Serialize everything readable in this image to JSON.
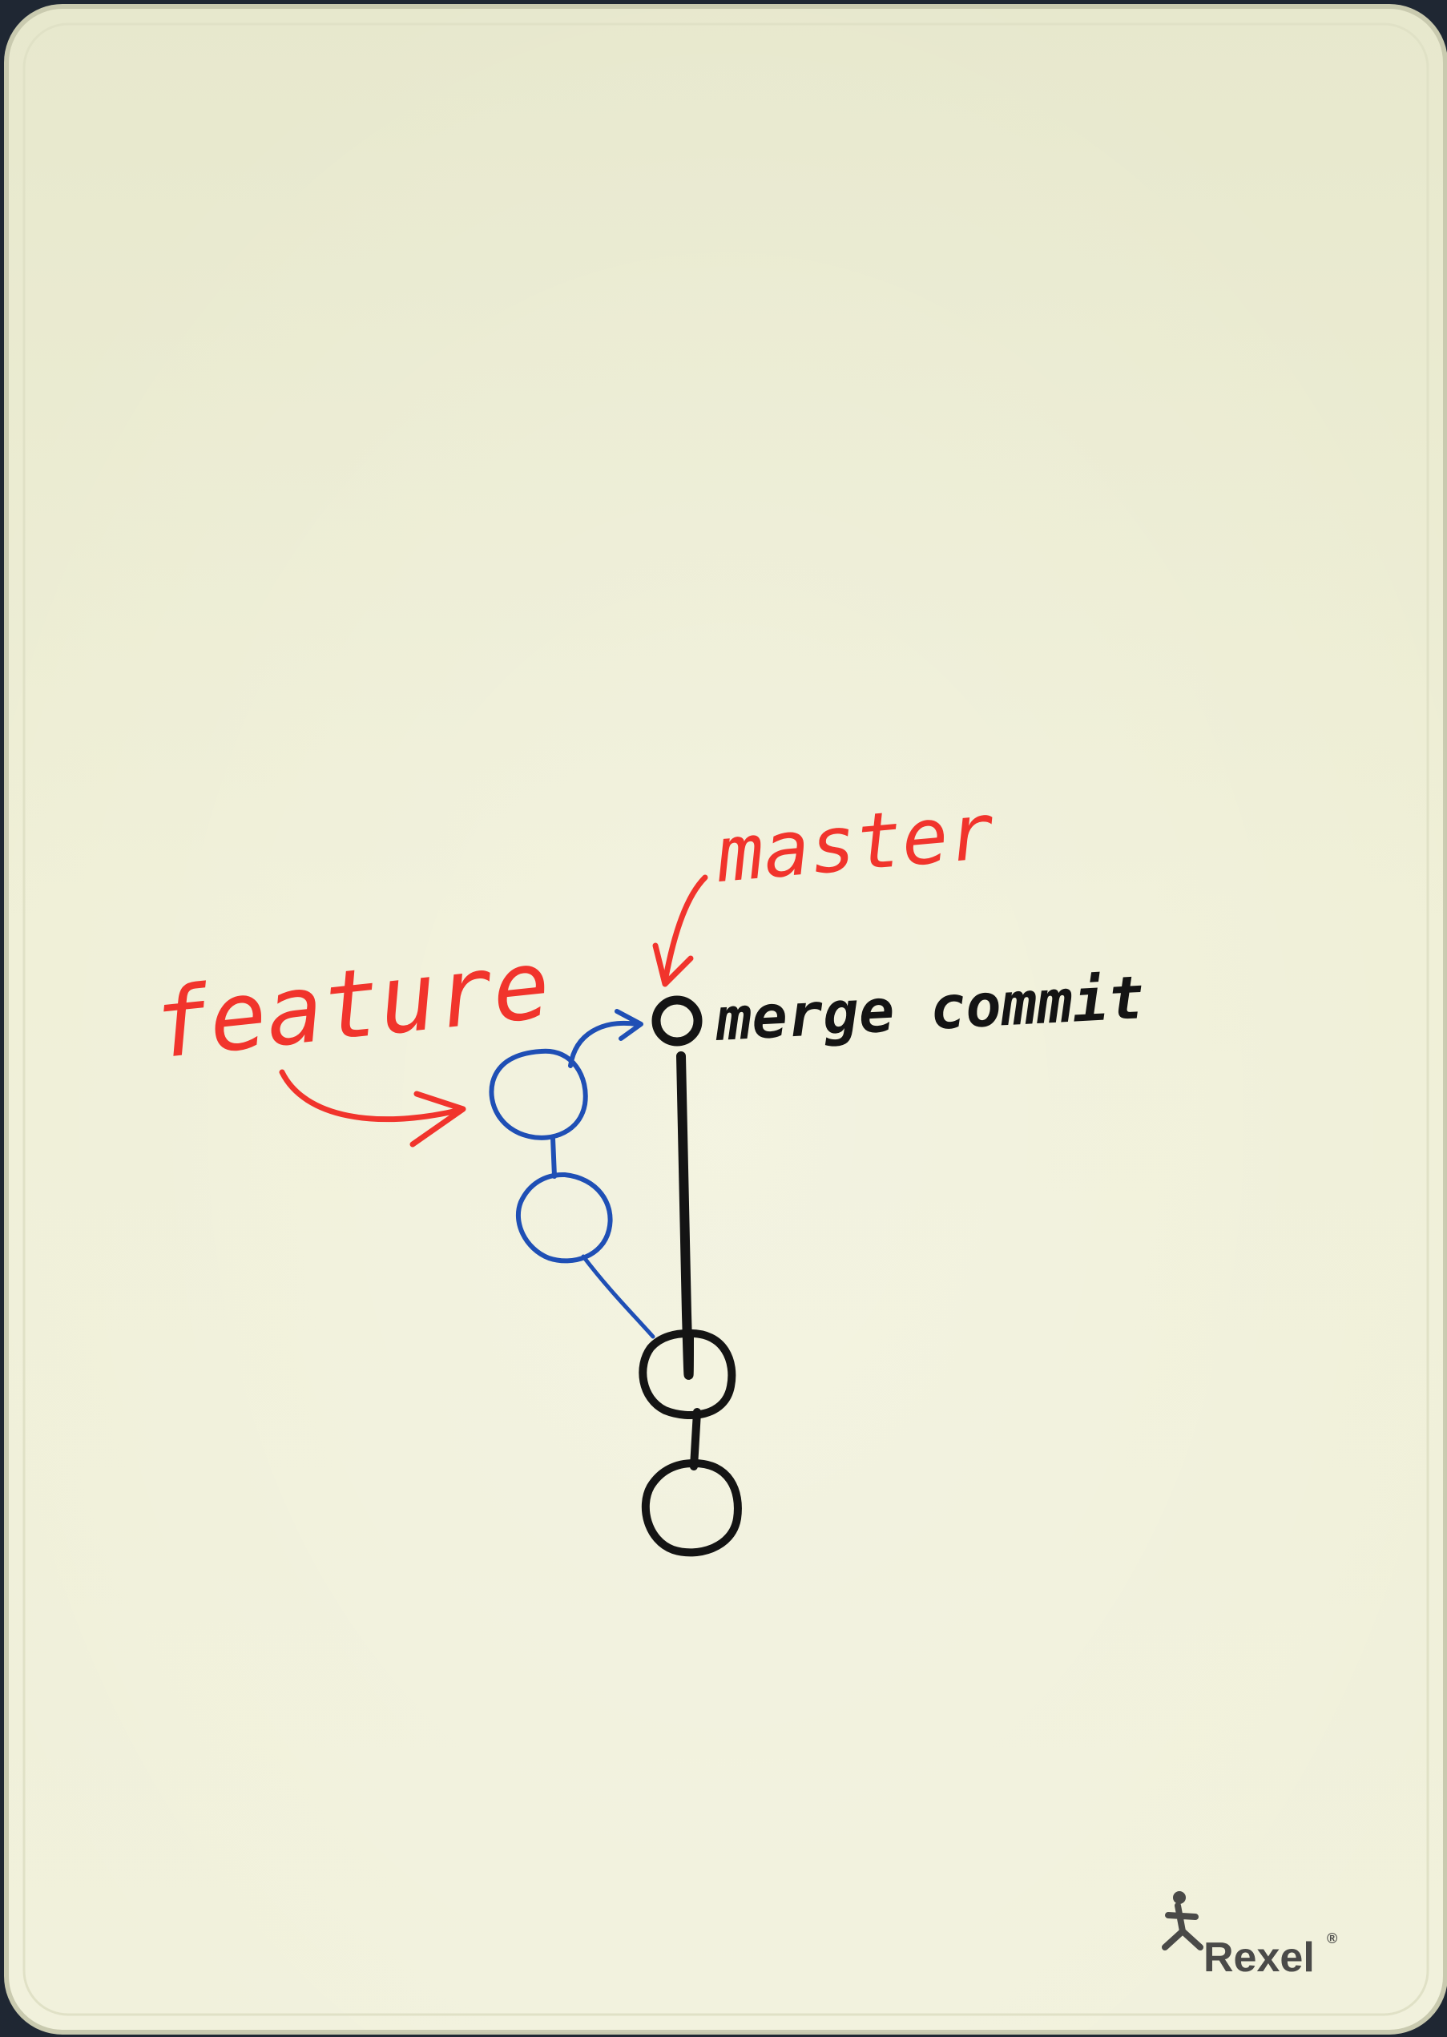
{
  "board": {
    "brand": "Rexel",
    "brand_mark": "®"
  },
  "diagram": {
    "labels": {
      "feature": "feature",
      "master": "master",
      "merge_commit": "merge commit"
    },
    "colors": {
      "board": "#eeeed5",
      "board_edge": "#cfd0b6",
      "frame": "#1f2733",
      "red_marker": "#f1342c",
      "blue_marker": "#1f4fb5",
      "black_marker": "#141414",
      "brand_text": "#4a4a48"
    },
    "commits": [
      {
        "id": "merge",
        "branch": "master"
      },
      {
        "id": "f2",
        "branch": "feature"
      },
      {
        "id": "f1",
        "branch": "feature"
      },
      {
        "id": "base",
        "branch": "master"
      },
      {
        "id": "root",
        "branch": "master"
      }
    ]
  }
}
